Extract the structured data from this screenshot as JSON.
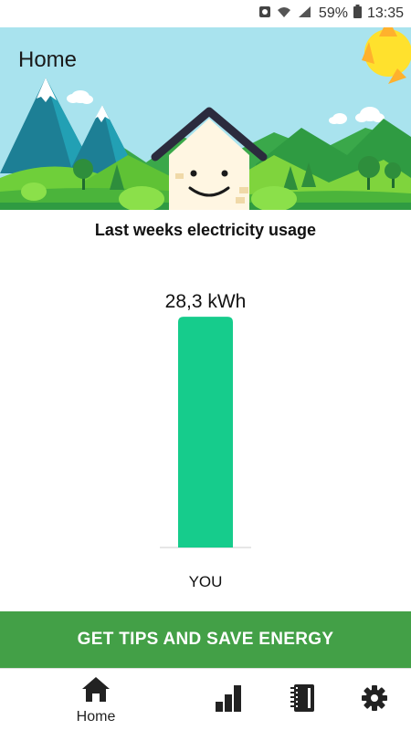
{
  "status_bar": {
    "battery_percent": "59%",
    "time": "13:35",
    "icons": [
      "notification-icon",
      "wifi-icon",
      "signal-icon",
      "battery-icon"
    ]
  },
  "header": {
    "title": "Home",
    "sky_color": "#a9e3ee"
  },
  "chart": {
    "title": "Last weeks electricity usage"
  },
  "chart_data": {
    "type": "bar",
    "categories": [
      "YOU"
    ],
    "values": [
      28.3
    ],
    "value_labels": [
      "28,3 kWh"
    ],
    "unit": "kWh",
    "bar_color": "#16cc8c",
    "ylim": [
      0,
      30
    ],
    "title": "Last weeks electricity usage",
    "xlabel": "",
    "ylabel": ""
  },
  "cta": {
    "label": "GET TIPS AND SAVE ENERGY",
    "color": "#43a047"
  },
  "bottom_nav": {
    "items": [
      {
        "label": "Home",
        "icon": "home-icon"
      },
      {
        "label": "",
        "icon": "bar-chart-icon"
      },
      {
        "label": "",
        "icon": "notebook-icon"
      },
      {
        "label": "",
        "icon": "settings-icon"
      }
    ]
  }
}
